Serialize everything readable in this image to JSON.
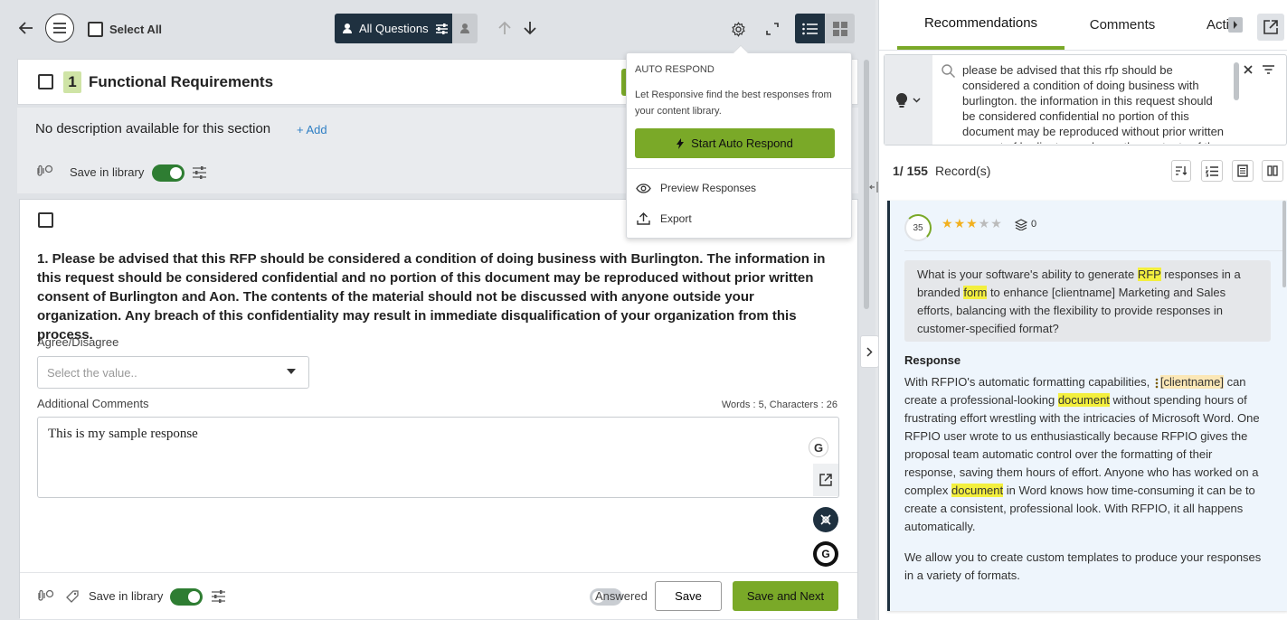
{
  "toolbar": {
    "select_all": "Select All",
    "filter_label": "All Questions"
  },
  "section": {
    "number": "1",
    "title": "Functional Requirements",
    "no_description": "No description available for this section",
    "add_label": "+ Add",
    "save_in_library": "Save in library"
  },
  "question": {
    "text": "1. Please be advised that this RFP should be considered a condition of doing business with Burlington. The information in this request should be considered confidential and no portion of this document may be reproduced without prior written consent of Burlington and Aon. The contents of the material should not be discussed with anyone outside your organization. Any breach of this confidentiality may result in immediate disqualification of your organization from this process.",
    "agree_label": "Agree/Disagree",
    "select_placeholder": "Select the value..",
    "comments_label": "Additional Comments",
    "word_count": "Words : 5, Characters : 26",
    "response_text": "This is my sample response",
    "save_in_library": "Save in library",
    "answered_label": "Answered",
    "save_button": "Save",
    "save_next_button": "Save and Next"
  },
  "auto_respond": {
    "heading": "AUTO RESPOND",
    "description": "Let Responsive find the best responses from your content library.",
    "start_button": "Start Auto Respond",
    "preview": "Preview Responses",
    "export": "Export"
  },
  "right_panel": {
    "tabs": [
      "Recommendations",
      "Comments",
      "Acti"
    ],
    "search_text": "please be advised that this rfp should be considered a condition of doing business with burlington. the information in this request should be considered confidential no portion of this document may be reproduced without prior written consent of burlington and aon. the contents of the material",
    "record_current": "1/ 155",
    "record_label": "Record(s)",
    "score": "35",
    "rating": 3,
    "rating_max": 5,
    "layer_count": "0",
    "rec_question_parts": [
      "What is your software's ability to generate ",
      "RFP",
      " responses in a branded ",
      "form",
      " to enhance [clientname] Marketing and Sales efforts, balancing with the flexibility to provide responses in customer-specified format?"
    ],
    "response_heading": "Response",
    "response_parts": [
      "With RFPIO's automatic formatting capabilities, ",
      "[clientname]",
      " can create a professional-looking ",
      "document",
      " without spending hours of frustrating effort wrestling with the intricacies of Microsoft Word. One RFPIO user wrote to us enthusiastically because RFPIO gives the proposal team automatic control over the formatting of their response, saving them hours of effort. Anyone who has worked on a complex ",
      "document",
      " in Word knows how time-consuming it can be to create a consistent, professional look. With RFPIO, it all happens automatically."
    ],
    "response_para2": "We allow you to create custom templates to produce your responses in a variety of formats."
  },
  "colors": {
    "accent_green": "#7aa928",
    "toggle_green": "#2e7d32",
    "dark_navy": "#1f3140",
    "highlight": "#f3ef3e"
  }
}
